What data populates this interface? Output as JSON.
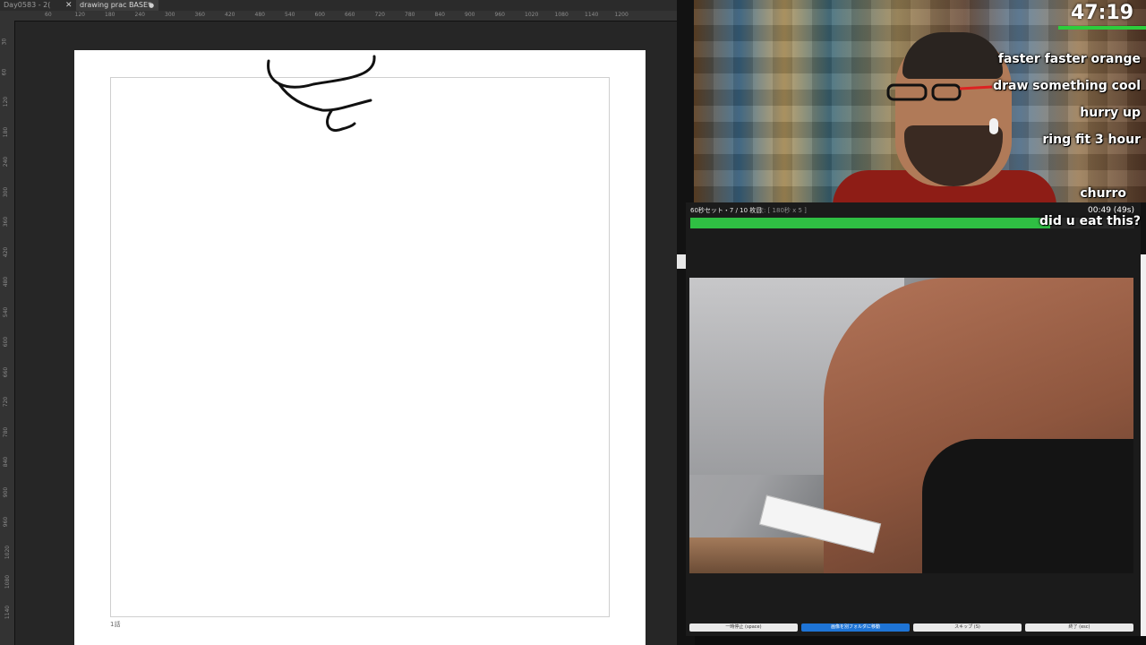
{
  "app": {
    "tabs": [
      {
        "label": "Day0583 - 2("
      },
      {
        "label": "drawing prac BASE*"
      }
    ],
    "ruler_top_ticks": [
      "60",
      "120",
      "180",
      "240",
      "300",
      "360",
      "420",
      "480",
      "540",
      "600",
      "660",
      "720",
      "780",
      "840",
      "900",
      "960",
      "1020",
      "1080",
      "1140",
      "1200"
    ],
    "ruler_left_ticks": [
      "30",
      "60",
      "120",
      "180",
      "240",
      "300",
      "360",
      "420",
      "480",
      "540",
      "600",
      "660",
      "720",
      "780",
      "840",
      "900",
      "960",
      "1020",
      "1080",
      "1140"
    ],
    "page_number": "1話"
  },
  "stream": {
    "timer": "47:19",
    "chat": [
      "faster faster orange",
      "draw something cool",
      "hurry up",
      "ring fit 3 hour",
      "churro",
      "did u eat this?"
    ],
    "colors": {
      "progress": "#2fbf43",
      "primary_button": "#1e74d6",
      "timer_bar": "#2ccd3b"
    }
  },
  "practice": {
    "label": "60秒セット・7 / 10 枚目",
    "sub_label": "次: [ 180秒 x 5 ]",
    "time": "00:49 (49s)",
    "progress": 0.81,
    "buttons": [
      {
        "label": "一時停止 (space)"
      },
      {
        "label": "画像を別フォルダに移動"
      },
      {
        "label": "スキップ (S)"
      },
      {
        "label": "終了 (esc)"
      }
    ]
  }
}
